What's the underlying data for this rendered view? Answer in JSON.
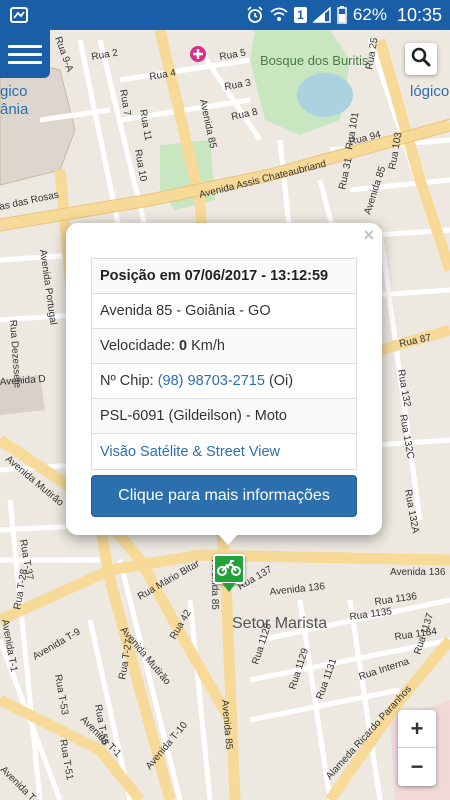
{
  "status_bar": {
    "battery": "62%",
    "time": "10:35",
    "sim_badge": "1",
    "icons": [
      "app-notification-icon",
      "alarm-icon",
      "wifi-icon",
      "signal-icon",
      "battery-icon"
    ]
  },
  "map": {
    "areas": {
      "bosque": "Bosque dos Buritis",
      "setor": "Setor Marista",
      "partial_left_top": "gico",
      "partial_left_bottom": "ânia",
      "partial_right": "lógico"
    },
    "streets": {
      "assis": "Avenida Assis Chateaubriand",
      "das_rosas": "as das Rosas",
      "portugal": "Avenida Portugal",
      "avenida_d": "Avenida D",
      "mutirao1": "Avenida Mutirão",
      "mutirao2": "Avenida Mutirão",
      "t9": "Avenida T-9",
      "t1": "Avenida T-1",
      "t1b": "Avenida T-1",
      "t10": "Avenida T-10",
      "t2": "Avenida T-2",
      "av85a": "Avenida 85",
      "av85b": "Avenida 85",
      "av85c": "Avenida 85",
      "av136a": "Avenida 136",
      "av136b": "Avenida 136",
      "ricardo": "Alameda Ricardo Paranhos",
      "rua94": "Rua 94",
      "rua87": "Rua 87",
      "rua2": "Rua 2",
      "rua4": "Rua 4",
      "rua3": "Rua 3",
      "rua5": "Rua 5",
      "rua7": "Rua 7",
      "rua8": "Rua 8",
      "rua10": "Rua 10",
      "rua11": "Rua 11",
      "rua9a": "Rua 9-A",
      "rua101": "Rua 101",
      "rua103": "Rua 103",
      "rua25": "Rua 25",
      "rua31": "Rua 31",
      "rua37": "Rua 37",
      "rua137": "Rua 137",
      "rua1137": "Rua 1137",
      "rua1128": "Rua 1128",
      "rua1131": "Rua 1131",
      "rua1135": "Rua 1135",
      "rua1134": "Rua 1134",
      "rua1136": "Rua 1136",
      "rua1129": "Rua 1129",
      "rua132": "Rua 132",
      "rua132a": "Rua 132A",
      "rua132c": "Rua 132C",
      "rua42": "Rua 42",
      "mario_bita": "Rua Mário Bitar",
      "interna": "Rua Interna",
      "dezessete": "Rua Dezessete",
      "rua_t53": "Rua T-53",
      "rua_t55": "Rua T-55",
      "rua_t27": "Rua T-27",
      "rua_t28": "Rua T-28",
      "rua_t51": "Rua T-51",
      "rua_t37": "Rua T-37"
    }
  },
  "popup": {
    "header": "Posição em 07/06/2017 - 13:12:59",
    "address": "Avenida 85 - Goiânia - GO",
    "speed_label": "Velocidade:",
    "speed_value": "0",
    "speed_unit": "Km/h",
    "chip_label": "Nº Chip:",
    "chip_number": "(98) 98703-2715",
    "chip_carrier": "(Oi)",
    "vehicle": "PSL-6091 (Gildeilson) - Moto",
    "satellite_link": "Visão Satélite & Street View",
    "more_button": "Clique para mais informações",
    "close": "×"
  },
  "controls": {
    "zoom_in": "+",
    "zoom_out": "−"
  },
  "colors": {
    "status_bar": "#1a5ea8",
    "marker": "#23a23a",
    "button": "#2b6fad",
    "link": "#2a6fb0"
  }
}
